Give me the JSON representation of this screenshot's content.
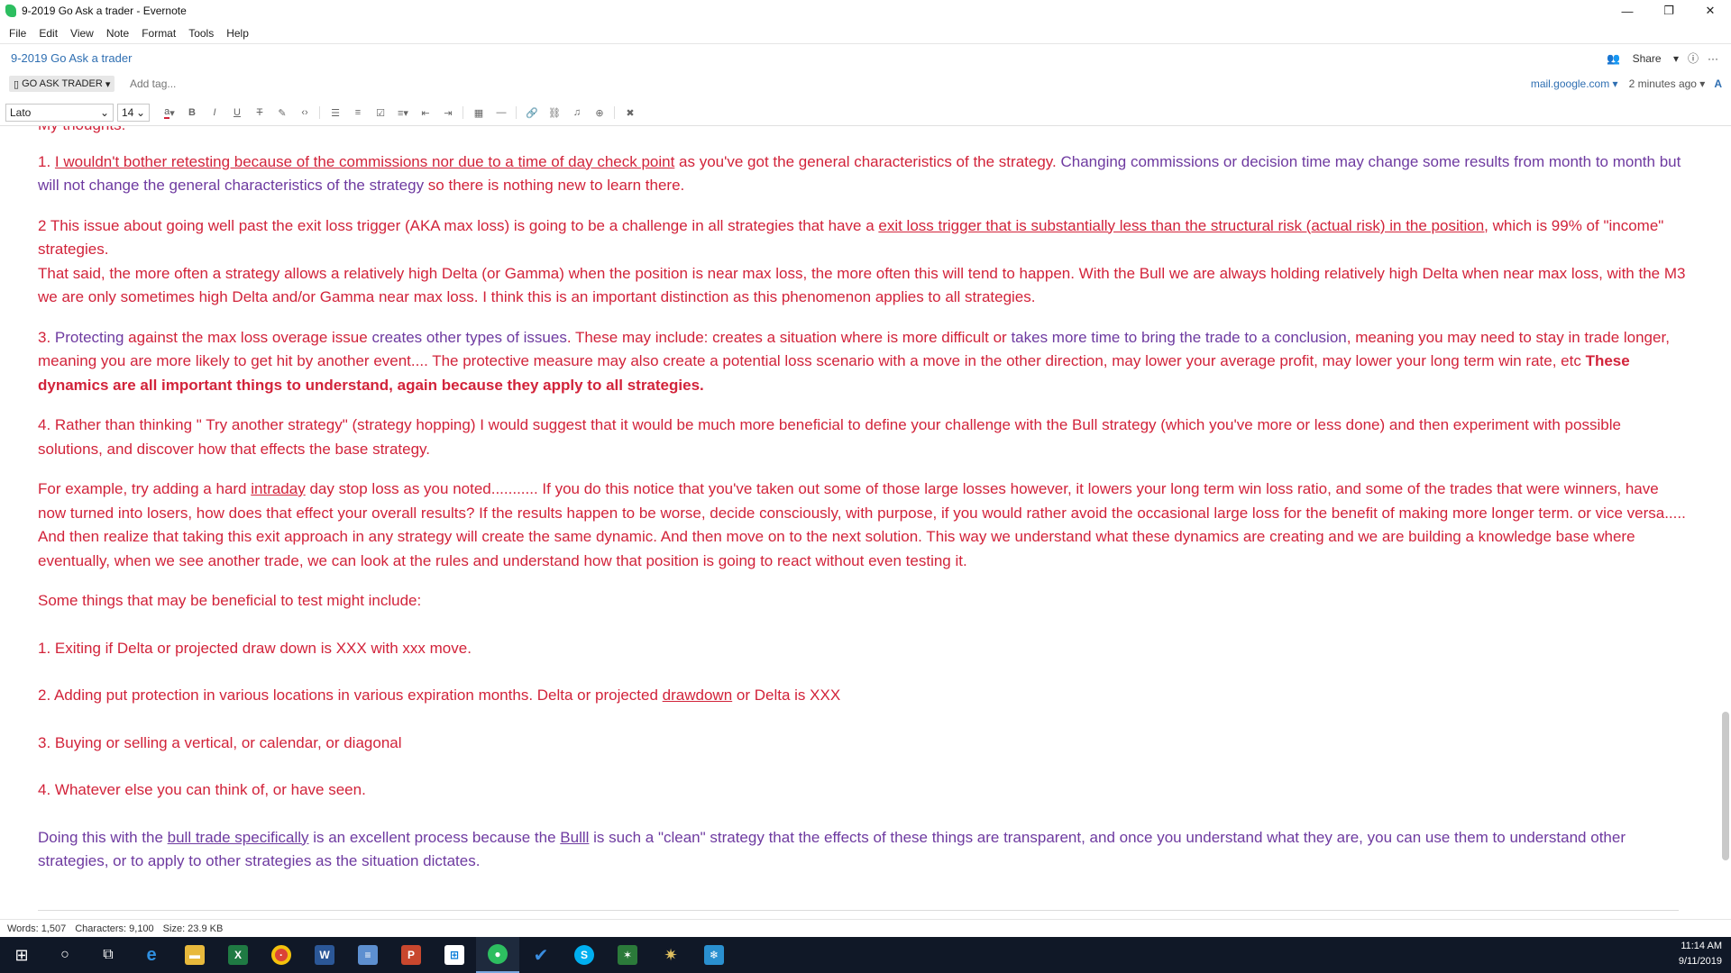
{
  "window": {
    "title": "9-2019 Go Ask a trader - Evernote",
    "controls": [
      "—",
      "❐",
      "✕"
    ]
  },
  "menu": [
    "File",
    "Edit",
    "View",
    "Note",
    "Format",
    "Tools",
    "Help"
  ],
  "note": {
    "title": "9-2019 Go Ask a trader",
    "notebook": "GO ASK TRADER",
    "tag_placeholder": "Add tag...",
    "share": "Share",
    "source": "mail.google.com",
    "updated": "2 minutes ago"
  },
  "toolbar": {
    "font": "Lato",
    "size": "14"
  },
  "body": {
    "p0": "My thoughts:",
    "p1_a": "1. ",
    "p1_b": "I wouldn't bother retesting because of the commissions nor due to a time of day check point",
    "p1_c": " as you've got the general characteristics of the strategy. ",
    "p1_d": "Changing commissions or decision time may change some results from month to month but will not change the general characteristics of the strategy",
    "p1_e": " so there is nothing new to learn there.",
    "p2_a": "2 This issue about going well past the exit loss trigger (AKA max loss) is going to be a challenge in all strategies that have a ",
    "p2_b": "exit loss trigger that is substantially less than the structural risk (actual risk) in the position,",
    "p2_c": " which is 99% of \"income\" strategies.",
    "p2_d": "That said, the more often a strategy allows a relatively high Delta (or Gamma) when the position is near max loss, the more often this will tend to happen. With the Bull we are always holding relatively high Delta when near max loss, with the M3 we are only sometimes high Delta and/or Gamma near max loss. I think this is an important distinction as this phenomenon applies to all strategies.",
    "p3_a": "3. ",
    "p3_b": "Protecting",
    "p3_c": " against the max loss overage issue ",
    "p3_d": "creates other types of issues",
    "p3_e": ". These may include: creates a situation where is more difficult or ",
    "p3_f": "takes more time to bring the trade to a conclusion",
    "p3_g": ", meaning you may need to stay in trade longer, meaning you are more likely to get hit by another event.... The protective measure may also create a potential loss scenario with a move in the other direction, may lower your average profit, may lower your long term win rate, etc  ",
    "p3_h": "These dynamics are all important things to understand, again because they apply to all strategies.",
    "p4": "4. Rather than thinking  \" Try another strategy\" (strategy hopping) I would suggest that it would be much more beneficial to define your challenge with the Bull strategy (which you've more or less done) and then experiment with possible solutions, and discover how that effects the base strategy.",
    "p5_a": "For example, try adding a hard ",
    "p5_b": "intraday",
    "p5_c": " day stop loss as you noted........... If you do this notice that you've taken out some of those large losses however, it lowers your long term win loss ratio, and some of the trades that were winners, have now turned into losers, how does that effect your overall results? If the results happen to be worse, decide consciously, with purpose, if you would rather avoid the occasional large loss for the benefit of making more longer term. or vice versa..... And then realize that taking this exit approach in any strategy will create the same dynamic. And then move on to the next solution. This way we understand what these dynamics are creating and we are building a knowledge base where eventually, when we see another trade, we can look at the rules and understand how that position is going to react without even testing it.",
    "p6": "Some things that may be beneficial to test might include:",
    "l1": "1. Exiting if Delta or projected draw down is XXX  with xxx move.",
    "l2_a": "2. Adding put protection in various locations in various expiration months. Delta or projected ",
    "l2_b": "drawdown",
    "l2_c": " or Delta is XXX",
    "l3": "3. Buying or selling a vertical, or calendar, or diagonal",
    "l4": "4. Whatever else you can think of, or have seen.",
    "p7_a": "Doing this with the ",
    "p7_b": "bull trade specifically",
    "p7_c": " is an excellent process because the ",
    "p7_d": "Bulll",
    "p7_e": " is such a \"clean\" strategy that the effects of these things are transparent, and once you understand what they are, you can use them to understand other strategies, or to apply to other strategies as the situation dictates."
  },
  "status": {
    "words": "Words: 1,507",
    "chars": "Characters: 9,100",
    "size": "Size: 23.9 KB"
  },
  "taskbar": {
    "time": "11:14 AM",
    "date": "9/11/2019",
    "apps": [
      "start-icon",
      "search-icon",
      "task-view-icon",
      "edge-icon",
      "file-explorer-icon",
      "excel-icon",
      "chrome-icon",
      "word-icon",
      "notepad-icon",
      "powerpoint-icon",
      "store-icon",
      "evernote-icon",
      "todo-icon",
      "skype-icon",
      "app-icon-green",
      "app-icon-insect",
      "app-icon-snowflake"
    ]
  },
  "colors": {
    "text_red": "#d2233a",
    "text_purple": "#6e3aa0",
    "link_blue": "#2f6fb2",
    "taskbar": "#101827"
  }
}
